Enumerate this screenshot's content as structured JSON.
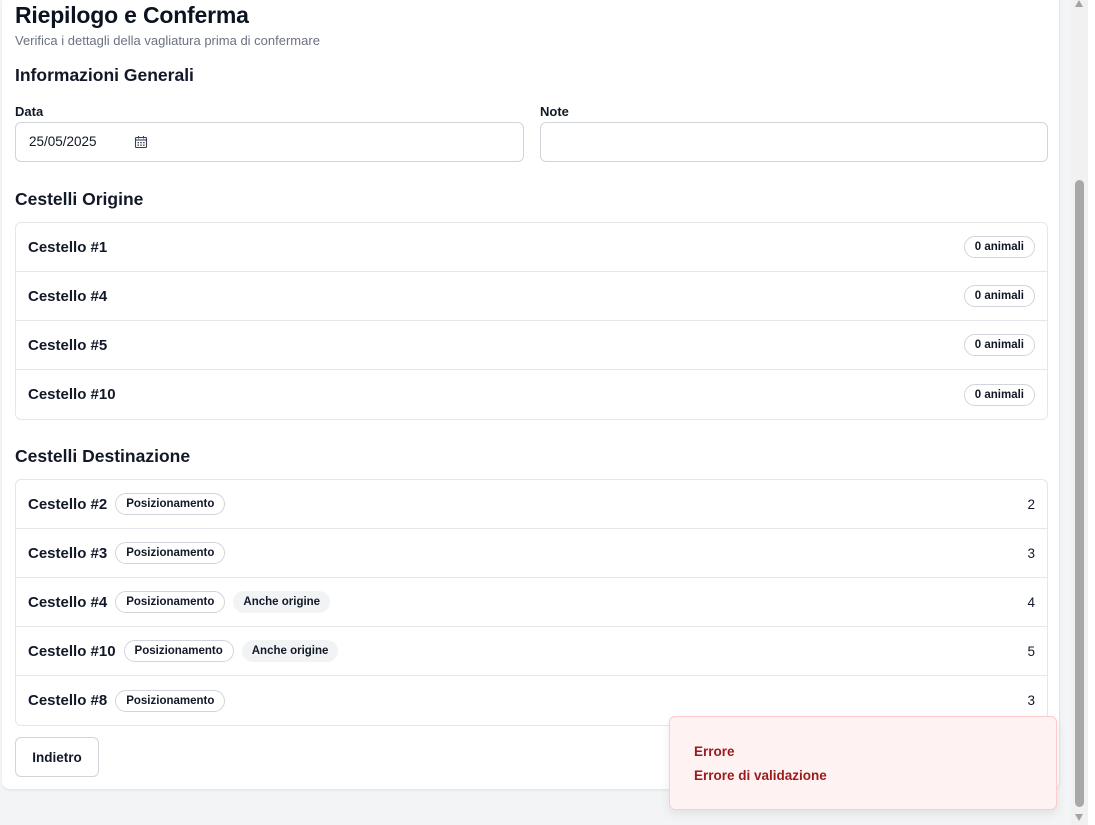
{
  "header": {
    "title": "Riepilogo e Conferma",
    "subtitle": "Verifica i dettagli della vagliatura prima di confermare"
  },
  "general": {
    "title": "Informazioni Generali",
    "date_label": "Data",
    "date_value": "25/05/2025",
    "date_icon": "calendar-icon",
    "note_label": "Note",
    "note_value": ""
  },
  "origin": {
    "title": "Cestelli Origine",
    "items": [
      {
        "name": "Cestello #1",
        "badge": "0 animali"
      },
      {
        "name": "Cestello #4",
        "badge": "0 animali"
      },
      {
        "name": "Cestello #5",
        "badge": "0 animali"
      },
      {
        "name": "Cestello #10",
        "badge": "0 animali"
      }
    ]
  },
  "destination": {
    "title": "Cestelli Destinazione",
    "items": [
      {
        "name": "Cestello #2",
        "type": "Posizionamento",
        "extra": "",
        "count": "2"
      },
      {
        "name": "Cestello #3",
        "type": "Posizionamento",
        "extra": "",
        "count": "3"
      },
      {
        "name": "Cestello #4",
        "type": "Posizionamento",
        "extra": "Anche origine",
        "count": "4"
      },
      {
        "name": "Cestello #10",
        "type": "Posizionamento",
        "extra": "Anche origine",
        "count": "5"
      },
      {
        "name": "Cestello #8",
        "type": "Posizionamento",
        "extra": "",
        "count": "3"
      }
    ]
  },
  "actions": {
    "back_label": "Indietro"
  },
  "toast": {
    "title": "Errore",
    "description": "Errore di validazione",
    "color": "#991b1b"
  }
}
